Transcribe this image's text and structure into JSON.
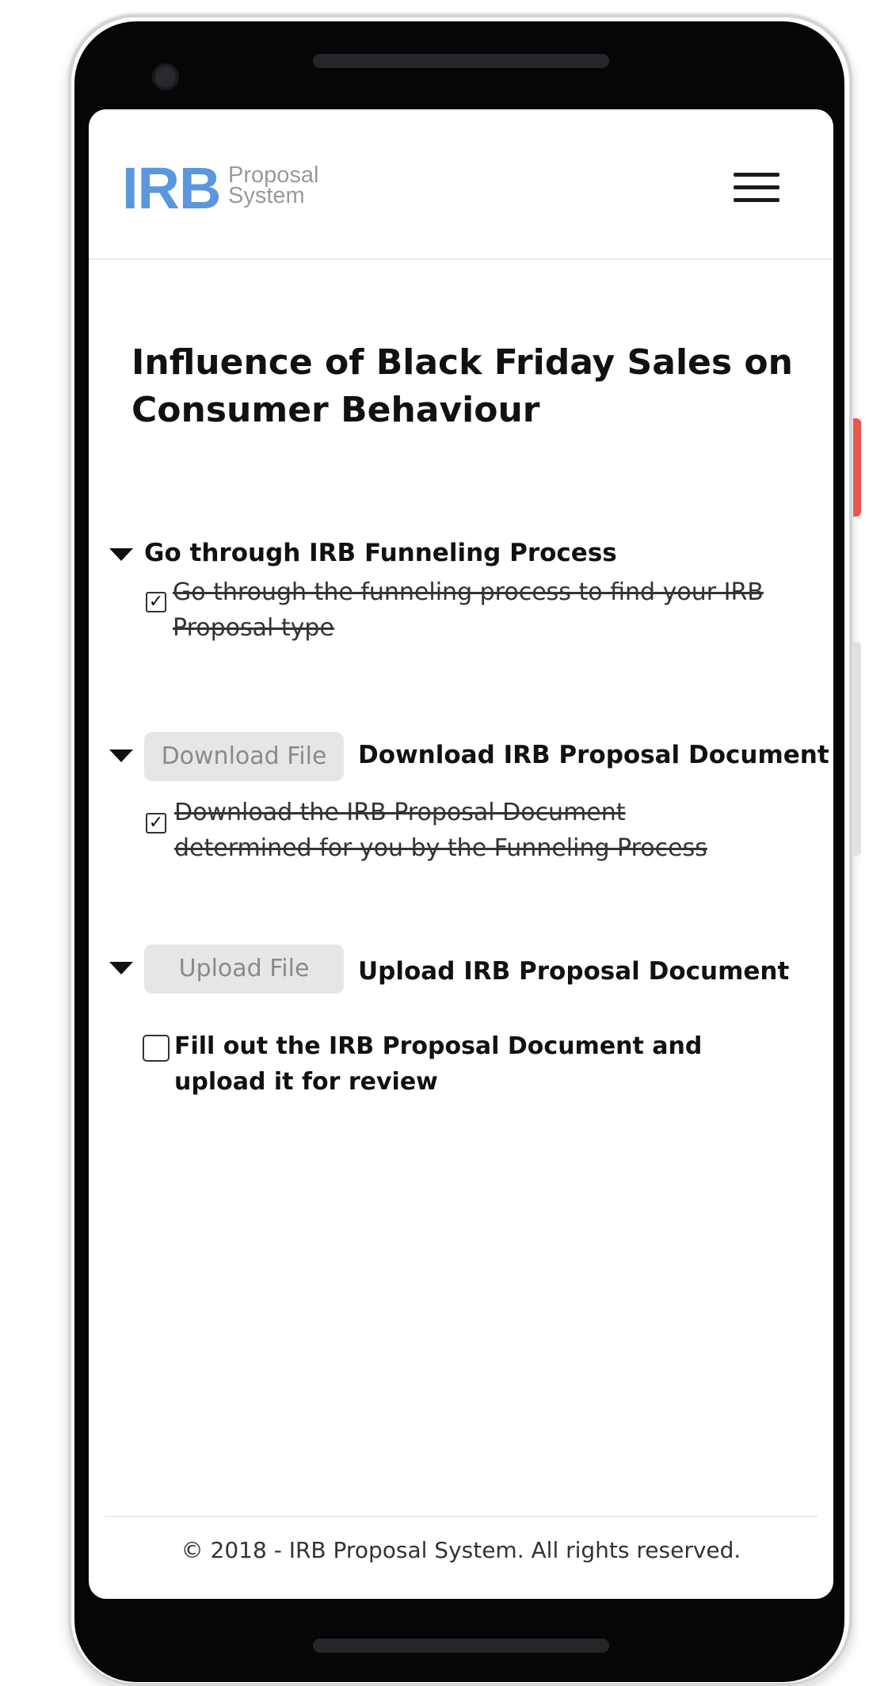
{
  "header": {
    "logo_main": "IRB",
    "logo_sub": "Proposal System",
    "menu_icon": "hamburger-menu-icon"
  },
  "page_title": "Influence of Black Friday Sales on Consumer Behaviour",
  "sections": [
    {
      "label": "Go through IRB Funneling Process",
      "task": "Go through the funneling process to find your IRB Proposal type",
      "task_checked": true
    },
    {
      "button": "Download File",
      "label": "Download IRB Proposal Document",
      "task": "Download the IRB Proposal Document determined for you by the Funneling Process",
      "task_checked": true
    },
    {
      "button": "Upload File",
      "label": "Upload IRB Proposal Document",
      "task": "Fill out the IRB Proposal Document and upload it for review",
      "task_checked": false
    }
  ],
  "checkmark": "✓",
  "footer": {
    "text": "© 2018 - IRB Proposal System. All rights reserved."
  },
  "colors": {
    "brand_blue": "#5b97dc",
    "button_bg": "#e6e6e6",
    "button_text": "#8a8a8a"
  }
}
